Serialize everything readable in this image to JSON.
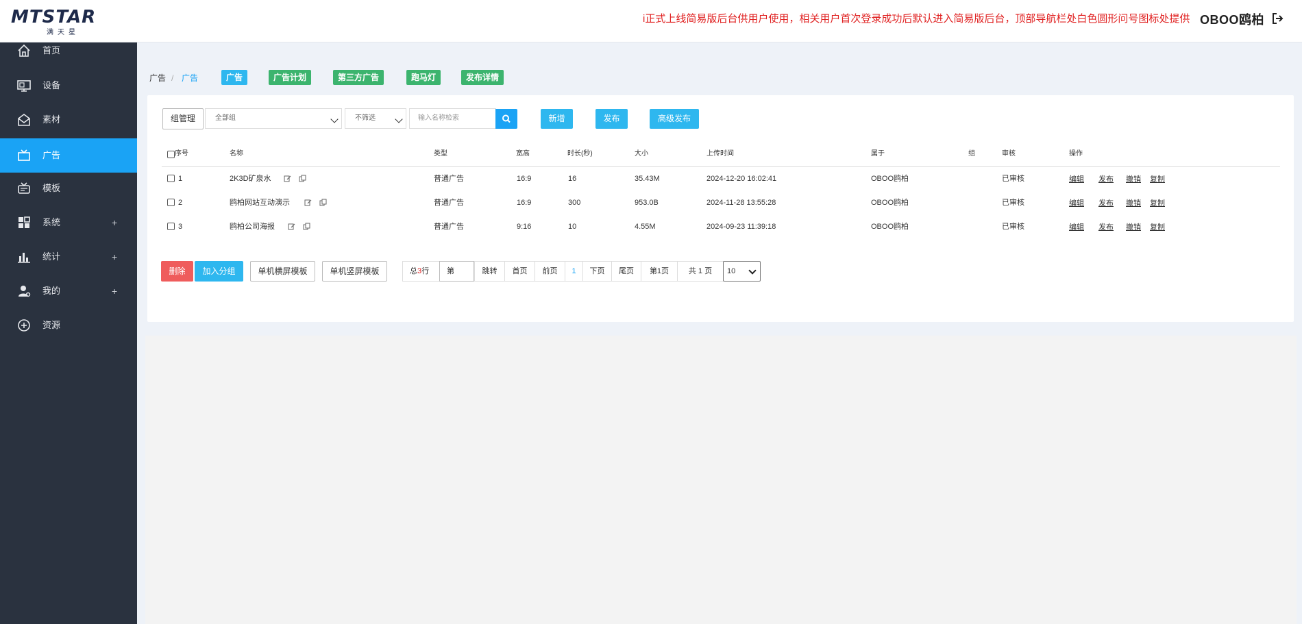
{
  "header": {
    "logo_text": "MTSTAR",
    "logo_sub": "满天星",
    "marquee": "i正式上线简易版后台供用户使用，相关用户首次登录成功后默认进入简易版后台，顶部导航栏处白色圆形问号图标处提供",
    "username": "OBOO鸥柏"
  },
  "sidebar": {
    "items": [
      {
        "label": "首页",
        "icon": "home-icon",
        "expandable": false,
        "active": false
      },
      {
        "label": "设备",
        "icon": "monitor-icon",
        "expandable": false,
        "active": false
      },
      {
        "label": "素材",
        "icon": "mail-icon",
        "expandable": false,
        "active": false
      },
      {
        "label": "广告",
        "icon": "tv-icon",
        "expandable": false,
        "active": true
      },
      {
        "label": "模板",
        "icon": "template-icon",
        "expandable": false,
        "active": false
      },
      {
        "label": "系统",
        "icon": "grid-icon",
        "expandable": true,
        "active": false
      },
      {
        "label": "统计",
        "icon": "bar-chart-icon",
        "expandable": true,
        "active": false
      },
      {
        "label": "我的",
        "icon": "user-icon",
        "expandable": true,
        "active": false
      },
      {
        "label": "资源",
        "icon": "plus-circle-icon",
        "expandable": false,
        "active": false
      }
    ],
    "plus": "+"
  },
  "breadcrumb": {
    "root": "广告",
    "sep": "/",
    "current": "广告"
  },
  "tabs": [
    {
      "label": "广告",
      "color": "#2eb7ef"
    },
    {
      "label": "广告计划",
      "color": "#3cb46e"
    },
    {
      "label": "第三方广告",
      "color": "#3cb46e"
    },
    {
      "label": "跑马灯",
      "color": "#3cb46e"
    },
    {
      "label": "发布详情",
      "color": "#3cb46e"
    }
  ],
  "toolbar": {
    "group_manage": "组管理",
    "group_select": "全部组",
    "filter_select": "不筛选",
    "search_placeholder": "输入名称检索",
    "add": "新增",
    "publish": "发布",
    "advanced_publish": "高级发布"
  },
  "table": {
    "headers": [
      "序号",
      "名称",
      "类型",
      "宽高",
      "时长(秒)",
      "大小",
      "上传时间",
      "属于",
      "组",
      "审核",
      "操作"
    ],
    "rows": [
      {
        "no": "1",
        "name": "2K3D矿泉水",
        "type": "普通广告",
        "ratio": "16:9",
        "duration": "16",
        "size": "35.43M",
        "uploaded": "2024-12-20 16:02:41",
        "owner": "OBOO鸥柏",
        "group": "",
        "review": "已审核"
      },
      {
        "no": "2",
        "name": "鸥柏网站互动演示",
        "type": "普通广告",
        "ratio": "16:9",
        "duration": "300",
        "size": "953.0B",
        "uploaded": "2024-11-28 13:55:28",
        "owner": "OBOO鸥柏",
        "group": "",
        "review": "已审核"
      },
      {
        "no": "3",
        "name": "鸥柏公司海报",
        "type": "普通广告",
        "ratio": "9:16",
        "duration": "10",
        "size": "4.55M",
        "uploaded": "2024-09-23 11:39:18",
        "owner": "OBOO鸥柏",
        "group": "",
        "review": "已审核"
      }
    ],
    "actions": [
      "编辑",
      "发布",
      "撤销",
      "复制"
    ]
  },
  "bottom": {
    "delete": "删除",
    "add_group": "加入分组",
    "single_landscape": "单机横屏模板",
    "single_portrait": "单机竖屏模板"
  },
  "pager": {
    "total_prefix": "总",
    "total_count": "3",
    "total_suffix": "行",
    "page_input": "第",
    "jump": "跳转",
    "first": "首页",
    "prev": "前页",
    "current": "1",
    "next": "下页",
    "last": "尾页",
    "page_of": "第1页",
    "total_pages": "共 1 页",
    "page_size": "10"
  },
  "colors": {
    "accent": "#1aa3f5",
    "sidebar": "#2a323f",
    "danger": "#ef5c5c",
    "success": "#3cb46e",
    "marquee": "#e02020"
  }
}
